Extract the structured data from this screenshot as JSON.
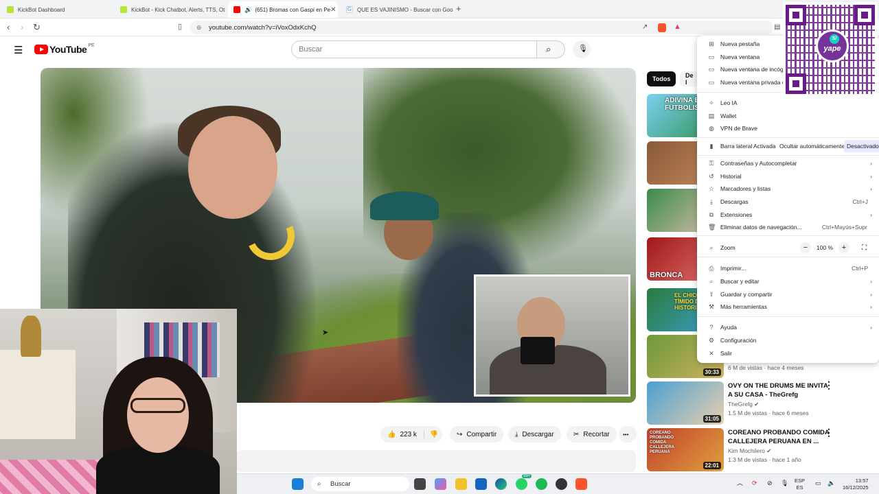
{
  "browser": {
    "tabs": [
      {
        "title": "KickBot Dashboard",
        "active": false
      },
      {
        "title": "KickBot - Kick Chatbot, Alerts, TTS, Ot",
        "active": false
      },
      {
        "title": "(651) Bromas con Gaspi en Pe",
        "active": true
      },
      {
        "title": "QUE ES VAJINISMO - Buscar con Goo",
        "active": false
      }
    ],
    "new_tab_icon": "+",
    "url": "youtube.com/watch?v=iVoxOdxKchQ"
  },
  "youtube": {
    "logo_text": "YouTube",
    "region": "PE",
    "search_placeholder": "Buscar",
    "chips": [
      "Todos",
      "De l"
    ],
    "actions": {
      "likes": "223 k",
      "share": "Compartir",
      "download": "Descargar",
      "clip": "Recortar",
      "more": "•••"
    },
    "recommendations": [
      {
        "thumb_text": "ADIVINA EL FUTBOLIS",
        "duration": "",
        "title": "",
        "channel": "",
        "meta": ""
      },
      {
        "thumb_text": "",
        "duration": "",
        "title": "",
        "channel": "",
        "meta": ""
      },
      {
        "thumb_text": "",
        "duration": "",
        "title": "",
        "channel": "",
        "meta": ""
      },
      {
        "thumb_text": "BRONCA",
        "duration": "",
        "title": "",
        "channel": "",
        "meta": ""
      },
      {
        "thumb_text": "EL CHICO MÁS TÍMIDO DE LA HISTORIA",
        "duration": "",
        "title": "",
        "channel": "",
        "meta": ""
      },
      {
        "thumb_text": "",
        "duration": "30:33",
        "title": "",
        "channel": "",
        "meta": "6 M de vistas · hace 4 meses"
      },
      {
        "thumb_text": "",
        "duration": "31:05",
        "title": "OVY ON THE DRUMS ME INVITA A SU CASA - TheGrefg",
        "channel": "TheGrefg",
        "meta": "1.5 M de vistas · hace 6 meses"
      },
      {
        "thumb_text": "COREANO PROBANDO COMIDA CALLEJERA PERUANA",
        "duration": "22:01",
        "title": "COREANO PROBANDO COMIDA CALLEJERA PERUANA EN ...",
        "channel": "Kim Mochilero",
        "meta": "1.3 M de vistas · hace 1 año"
      }
    ]
  },
  "brave_menu": {
    "items": [
      {
        "icon": "new-tab-icon",
        "label": "Nueva pestaña",
        "shortcut": "",
        "arrow": false
      },
      {
        "icon": "new-window-icon",
        "label": "Nueva ventana",
        "shortcut": "",
        "arrow": false
      },
      {
        "icon": "incognito-icon",
        "label": "Nueva ventana de incógn",
        "shortcut": "",
        "arrow": false
      },
      {
        "icon": "private-window-icon",
        "label": "Nueva ventana privada c",
        "shortcut": "",
        "arrow": false
      },
      {
        "icon": "leo-ai-icon",
        "label": "Leo IA",
        "shortcut": "",
        "arrow": false
      },
      {
        "icon": "wallet-icon",
        "label": "Wallet",
        "shortcut": "",
        "arrow": false
      },
      {
        "icon": "vpn-icon",
        "label": "VPN de Brave",
        "shortcut": "",
        "arrow": false
      },
      {
        "icon": "passwords-icon",
        "label": "Contraseñas y Autocompletar",
        "shortcut": "",
        "arrow": true
      },
      {
        "icon": "history-icon",
        "label": "Historial",
        "shortcut": "",
        "arrow": true
      },
      {
        "icon": "bookmarks-icon",
        "label": "Marcadores y listas",
        "shortcut": "",
        "arrow": true
      },
      {
        "icon": "downloads-icon",
        "label": "Descargas",
        "shortcut": "Ctrl+J",
        "arrow": false
      },
      {
        "icon": "extensions-icon",
        "label": "Extensiones",
        "shortcut": "",
        "arrow": true
      },
      {
        "icon": "clear-data-icon",
        "label": "Eliminar datos de navegación...",
        "shortcut": "Ctrl+Mayús+Supr",
        "arrow": false
      },
      {
        "icon": "print-icon",
        "label": "Imprimir...",
        "shortcut": "Ctrl+P",
        "arrow": false
      },
      {
        "icon": "find-icon",
        "label": "Buscar y editar",
        "shortcut": "",
        "arrow": true
      },
      {
        "icon": "save-share-icon",
        "label": "Guardar y compartir",
        "shortcut": "",
        "arrow": true
      },
      {
        "icon": "more-tools-icon",
        "label": "Más herramientas",
        "shortcut": "",
        "arrow": true
      },
      {
        "icon": "help-icon",
        "label": "Ayuda",
        "shortcut": "",
        "arrow": true
      },
      {
        "icon": "settings-icon",
        "label": "Configuración",
        "shortcut": "",
        "arrow": false
      },
      {
        "icon": "exit-icon",
        "label": "Salir",
        "shortcut": "",
        "arrow": false
      }
    ],
    "sidebar": {
      "label": "Barra lateral",
      "options": [
        "Activada",
        "Ocultar automáticamente",
        "Desactivado"
      ],
      "selected": "Desactivado"
    },
    "zoom": {
      "label": "Zoom",
      "minus": "−",
      "value": "100 %",
      "plus": "+"
    }
  },
  "qr_overlay": {
    "brand": "yape"
  },
  "taskbar": {
    "search_placeholder": "Buscar",
    "badge": "99+",
    "lang_top": "ESP",
    "lang_bottom": "ES",
    "time": "13:57",
    "date": "16/12/2025"
  },
  "colors": {
    "youtube_red": "#ff0000",
    "yape_purple": "#743399",
    "chip_active": "#0f0f0f",
    "menu_selected_bg": "#e8e8ff"
  }
}
